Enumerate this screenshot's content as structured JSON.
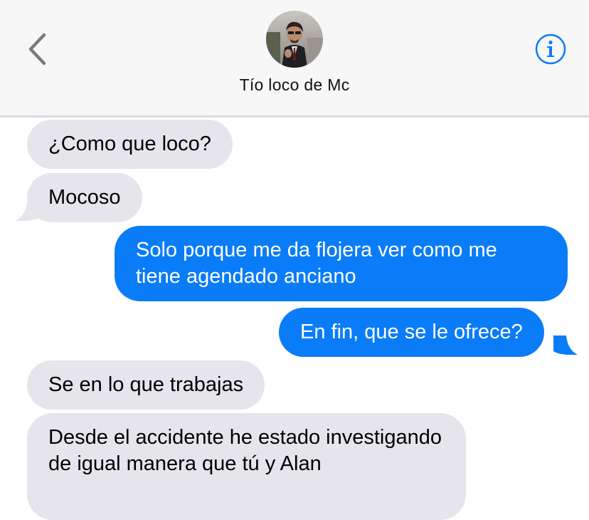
{
  "header": {
    "back_icon": "chevron-left-icon",
    "contact_name": "Tío loco de Mc",
    "info_icon": "info-icon",
    "accent_color": "#0a7cf8"
  },
  "messages": [
    {
      "direction": "incoming",
      "text": "¿Como que loco?"
    },
    {
      "direction": "incoming",
      "text": "Mocoso"
    },
    {
      "direction": "outgoing",
      "text": "Solo porque me da flojera ver como me tiene agendado anciano"
    },
    {
      "direction": "outgoing",
      "text": "En fin, que se le ofrece?"
    },
    {
      "direction": "incoming",
      "text": "Se en lo que trabajas"
    },
    {
      "direction": "incoming",
      "text": "Desde el accidente he estado investigando de igual manera que tú y Alan"
    }
  ],
  "colors": {
    "incoming_bubble": "#e6e5eb",
    "outgoing_bubble": "#0a7cf8",
    "header_bg": "#f7f7f8"
  }
}
